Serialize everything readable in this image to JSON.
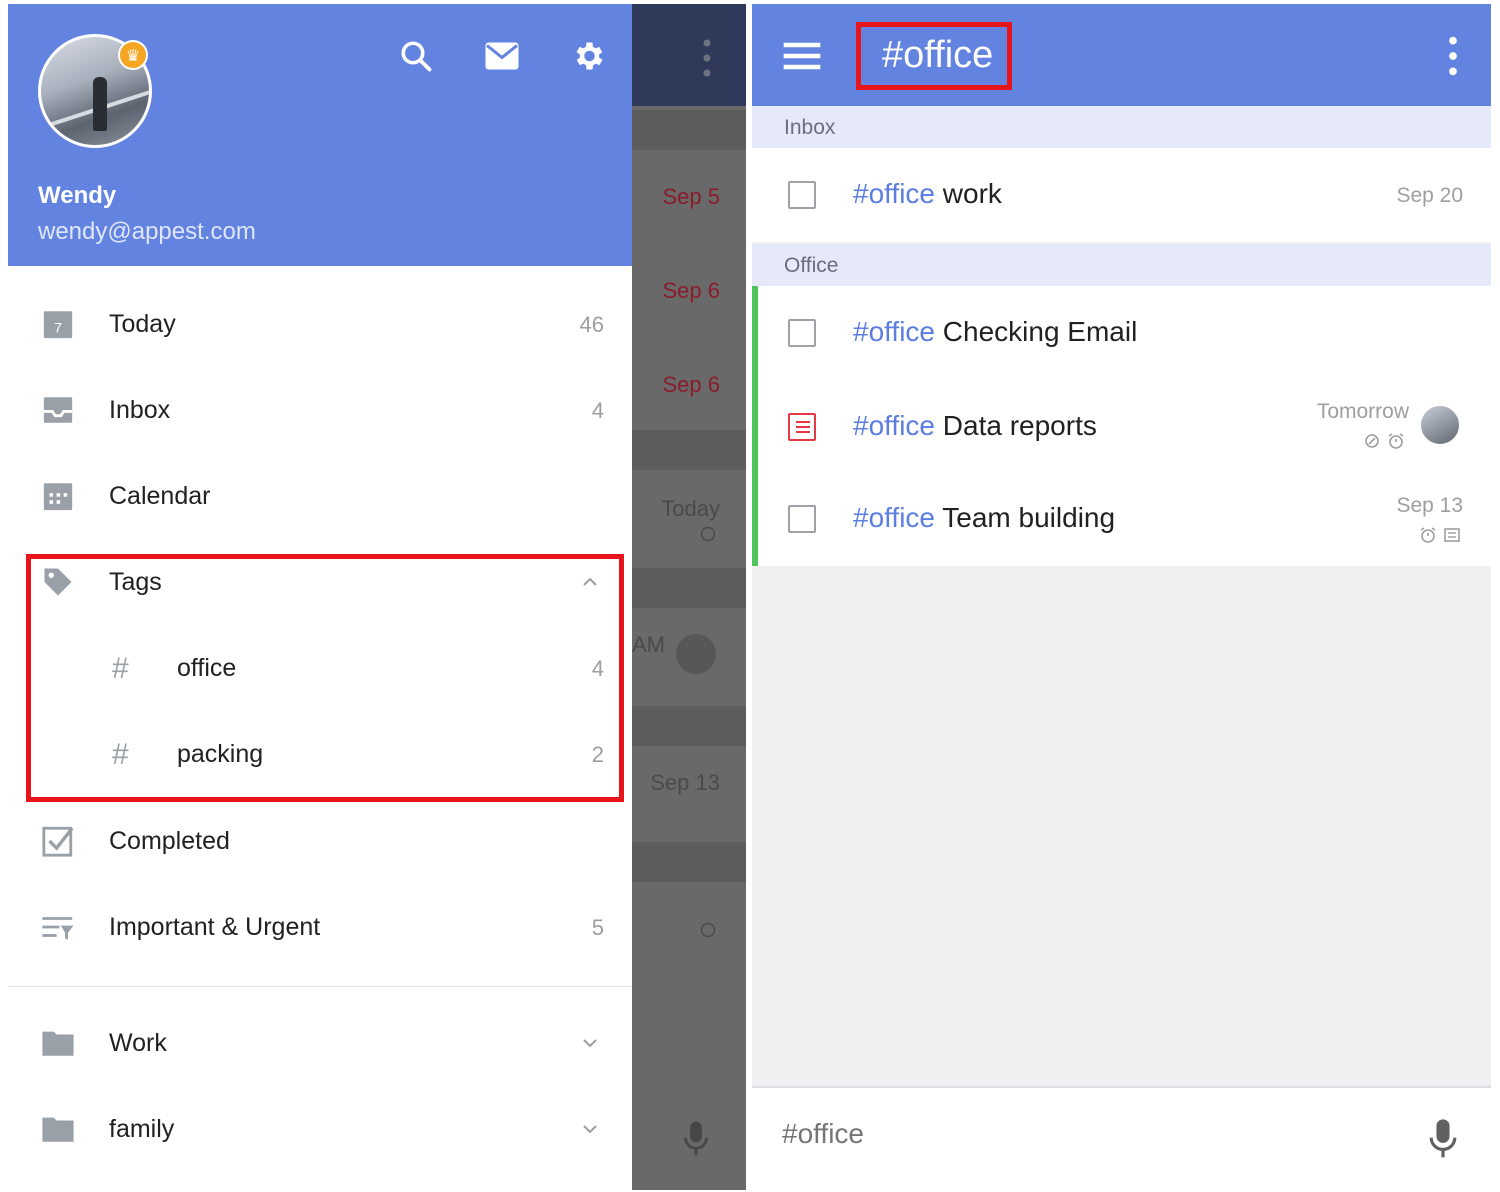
{
  "drawer": {
    "user": {
      "name": "Wendy",
      "email": "wendy@appest.com"
    },
    "header_icons": [
      "search-icon",
      "mail-icon",
      "gear-icon"
    ],
    "items": [
      {
        "icon": "calendar-today-icon",
        "icon_text": "7",
        "label": "Today",
        "count": "46"
      },
      {
        "icon": "inbox-icon",
        "label": "Inbox",
        "count": "4"
      },
      {
        "icon": "calendar-icon",
        "label": "Calendar",
        "count": ""
      }
    ],
    "tags": {
      "label": "Tags",
      "expanded": true,
      "items": [
        {
          "label": "office",
          "count": "4"
        },
        {
          "label": "packing",
          "count": "2"
        }
      ]
    },
    "bottom_items": [
      {
        "icon": "checkbox-checked-icon",
        "label": "Completed",
        "count": ""
      },
      {
        "icon": "priority-filter-icon",
        "label": "Important & Urgent",
        "count": "5"
      }
    ],
    "folders": [
      {
        "label": "Work"
      },
      {
        "label": "family"
      }
    ],
    "accent_color": "#6383e0",
    "highlight_color": "#e8141c"
  },
  "background_list": {
    "dates": [
      "Sep 5",
      "Sep 6",
      "Sep 6"
    ],
    "today_label": "Today",
    "am_label": "AM",
    "sep13_label": "Sep 13"
  },
  "tagview": {
    "title": "#office",
    "sections": [
      {
        "header": "Inbox",
        "tasks": [
          {
            "tag": "#office",
            "text": "work",
            "date": "Sep 20",
            "type": "checkbox"
          }
        ]
      },
      {
        "header": "Office",
        "tasks": [
          {
            "tag": "#office",
            "text": "Checking Email",
            "date": "",
            "type": "checkbox"
          },
          {
            "tag": "#office",
            "text": "Data reports",
            "date": "Tomorrow",
            "type": "note",
            "icons": [
              "repeat-icon",
              "alarm-icon"
            ],
            "has_assignee": true
          },
          {
            "tag": "#office",
            "text": "Team building",
            "date": "Sep 13",
            "type": "checkbox",
            "icons": [
              "alarm-icon",
              "note-icon"
            ]
          }
        ]
      }
    ],
    "composer": {
      "placeholder": "#office"
    },
    "tag_color": "#5b7ee0",
    "section_color": "#4fc65a"
  }
}
